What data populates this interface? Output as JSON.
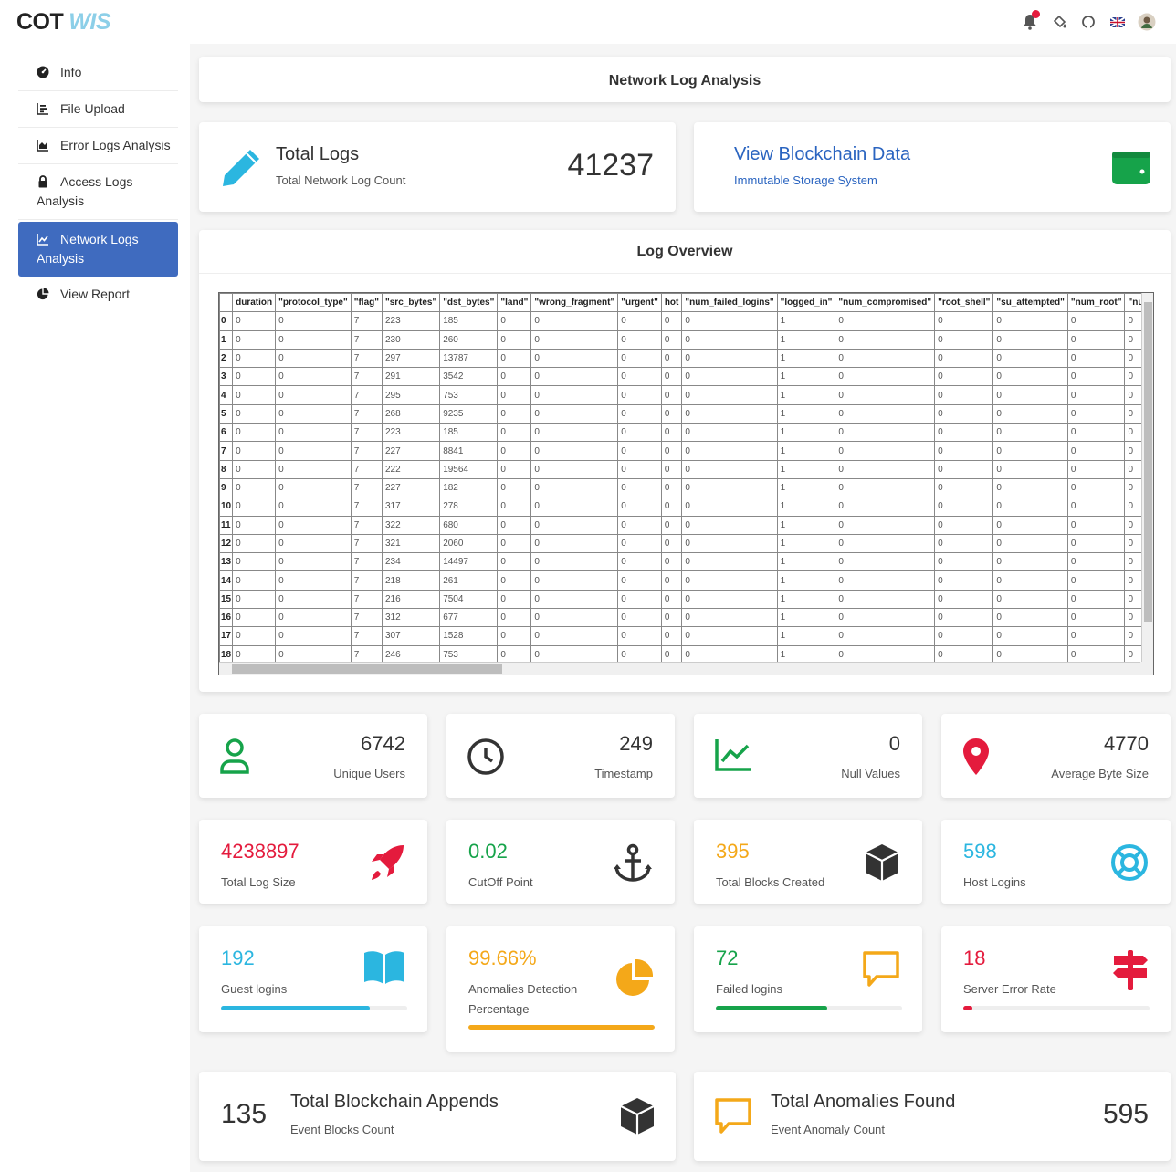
{
  "brand": {
    "part1": "COT",
    "part2": "WIS"
  },
  "colors": {
    "primary": "#3f6bbf",
    "green": "#16a34a",
    "red": "#e41b3d",
    "cyan": "#2bb6e0",
    "orange": "#f4a819",
    "blue_link": "#2a64c0"
  },
  "top_icons": [
    "bell-icon",
    "paint-bucket-icon",
    "github-icon",
    "flag-uk-icon",
    "avatar"
  ],
  "sidebar": {
    "items": [
      {
        "label": "Info",
        "icon": "dashboard-icon"
      },
      {
        "label": "File Upload",
        "icon": "bar-chart-icon"
      },
      {
        "label": "Error Logs Analysis",
        "icon": "area-chart-icon"
      },
      {
        "label": "Access Logs Analysis",
        "icon": "lock-icon"
      },
      {
        "label": "Network Logs Analysis",
        "icon": "line-chart-icon"
      },
      {
        "label": "View Report",
        "icon": "pie-chart-icon"
      }
    ]
  },
  "header": {
    "title": "Network Log Analysis"
  },
  "total_logs": {
    "title": "Total Logs",
    "subtitle": "Total Network Log Count",
    "value": "41237"
  },
  "blockchain": {
    "title": "View Blockchain Data",
    "subtitle": "Immutable Storage System"
  },
  "overview": {
    "title": "Log Overview",
    "columns": [
      "",
      "duration",
      "\"protocol_type\"",
      "\"flag\"",
      "\"src_bytes\"",
      "\"dst_bytes\"",
      "\"land\"",
      "\"wrong_fragment\"",
      "\"urgent\"",
      "hot",
      "\"num_failed_logins\"",
      "\"logged_in\"",
      "\"num_compromised\"",
      "\"root_shell\"",
      "\"su_attempted\"",
      "\"num_root\"",
      "\"num_file_creatio"
    ],
    "rows": [
      [
        "0",
        "0",
        "0",
        "7",
        "223",
        "185",
        "0",
        "0",
        "0",
        "0",
        "0",
        "1",
        "0",
        "0",
        "0",
        "0",
        "0"
      ],
      [
        "1",
        "0",
        "0",
        "7",
        "230",
        "260",
        "0",
        "0",
        "0",
        "0",
        "0",
        "1",
        "0",
        "0",
        "0",
        "0",
        "0"
      ],
      [
        "2",
        "0",
        "0",
        "7",
        "297",
        "13787",
        "0",
        "0",
        "0",
        "0",
        "0",
        "1",
        "0",
        "0",
        "0",
        "0",
        "0"
      ],
      [
        "3",
        "0",
        "0",
        "7",
        "291",
        "3542",
        "0",
        "0",
        "0",
        "0",
        "0",
        "1",
        "0",
        "0",
        "0",
        "0",
        "0"
      ],
      [
        "4",
        "0",
        "0",
        "7",
        "295",
        "753",
        "0",
        "0",
        "0",
        "0",
        "0",
        "1",
        "0",
        "0",
        "0",
        "0",
        "0"
      ],
      [
        "5",
        "0",
        "0",
        "7",
        "268",
        "9235",
        "0",
        "0",
        "0",
        "0",
        "0",
        "1",
        "0",
        "0",
        "0",
        "0",
        "0"
      ],
      [
        "6",
        "0",
        "0",
        "7",
        "223",
        "185",
        "0",
        "0",
        "0",
        "0",
        "0",
        "1",
        "0",
        "0",
        "0",
        "0",
        "0"
      ],
      [
        "7",
        "0",
        "0",
        "7",
        "227",
        "8841",
        "0",
        "0",
        "0",
        "0",
        "0",
        "1",
        "0",
        "0",
        "0",
        "0",
        "0"
      ],
      [
        "8",
        "0",
        "0",
        "7",
        "222",
        "19564",
        "0",
        "0",
        "0",
        "0",
        "0",
        "1",
        "0",
        "0",
        "0",
        "0",
        "0"
      ],
      [
        "9",
        "0",
        "0",
        "7",
        "227",
        "182",
        "0",
        "0",
        "0",
        "0",
        "0",
        "1",
        "0",
        "0",
        "0",
        "0",
        "0"
      ],
      [
        "10",
        "0",
        "0",
        "7",
        "317",
        "278",
        "0",
        "0",
        "0",
        "0",
        "0",
        "1",
        "0",
        "0",
        "0",
        "0",
        "0"
      ],
      [
        "11",
        "0",
        "0",
        "7",
        "322",
        "680",
        "0",
        "0",
        "0",
        "0",
        "0",
        "1",
        "0",
        "0",
        "0",
        "0",
        "0"
      ],
      [
        "12",
        "0",
        "0",
        "7",
        "321",
        "2060",
        "0",
        "0",
        "0",
        "0",
        "0",
        "1",
        "0",
        "0",
        "0",
        "0",
        "0"
      ],
      [
        "13",
        "0",
        "0",
        "7",
        "234",
        "14497",
        "0",
        "0",
        "0",
        "0",
        "0",
        "1",
        "0",
        "0",
        "0",
        "0",
        "0"
      ],
      [
        "14",
        "0",
        "0",
        "7",
        "218",
        "261",
        "0",
        "0",
        "0",
        "0",
        "0",
        "1",
        "0",
        "0",
        "0",
        "0",
        "0"
      ],
      [
        "15",
        "0",
        "0",
        "7",
        "216",
        "7504",
        "0",
        "0",
        "0",
        "0",
        "0",
        "1",
        "0",
        "0",
        "0",
        "0",
        "0"
      ],
      [
        "16",
        "0",
        "0",
        "7",
        "312",
        "677",
        "0",
        "0",
        "0",
        "0",
        "0",
        "1",
        "0",
        "0",
        "0",
        "0",
        "0"
      ],
      [
        "17",
        "0",
        "0",
        "7",
        "307",
        "1528",
        "0",
        "0",
        "0",
        "0",
        "0",
        "1",
        "0",
        "0",
        "0",
        "0",
        "0"
      ],
      [
        "18",
        "0",
        "0",
        "7",
        "246",
        "753",
        "0",
        "0",
        "0",
        "0",
        "0",
        "1",
        "0",
        "0",
        "0",
        "0",
        "0"
      ]
    ]
  },
  "stats": [
    {
      "value": "6742",
      "label": "Unique Users",
      "icon": "user-icon",
      "color": "#16a34a"
    },
    {
      "value": "249",
      "label": "Timestamp",
      "icon": "clock-icon",
      "color": "#333333"
    },
    {
      "value": "0",
      "label": "Null Values",
      "icon": "line-chart-icon",
      "color": "#16a34a"
    },
    {
      "value": "4770",
      "label": "Average Byte Size",
      "icon": "map-pin-icon",
      "color": "#e41b3d"
    }
  ],
  "metrics": [
    {
      "value": "4238897",
      "label": "Total Log Size",
      "icon": "rocket-icon",
      "color": "#e41b3d"
    },
    {
      "value": "0.02",
      "label": "CutOff Point",
      "icon": "anchor-icon",
      "color": "#16a34a"
    },
    {
      "value": "395",
      "label": "Total Blocks Created",
      "icon": "cube-icon",
      "color": "#f4a819"
    },
    {
      "value": "598",
      "label": "Host Logins",
      "icon": "life-ring-icon",
      "color": "#2bb6e0"
    }
  ],
  "progress": [
    {
      "value": "192",
      "label": "Guest logins",
      "icon": "book-icon",
      "color": "#2bb6e0",
      "fill_percent": 80
    },
    {
      "value": "99.66%",
      "label": "Anomalies Detection Percentage",
      "icon": "pie-chart-icon",
      "color": "#f4a819",
      "fill_percent": 100
    },
    {
      "value": "72",
      "label": "Failed logins",
      "icon": "comment-icon",
      "color": "#16a34a",
      "fill_percent": 60
    },
    {
      "value": "18",
      "label": "Server Error Rate",
      "icon": "signpost-icon",
      "color": "#e41b3d",
      "fill_percent": 5
    }
  ],
  "bottom": [
    {
      "value": "135",
      "title": "Total Blockchain Appends",
      "subtitle": "Event Blocks Count",
      "icon": "cube-icon"
    },
    {
      "value": "595",
      "title": "Total Anomalies Found",
      "subtitle": "Event Anomaly Count",
      "icon": "comment-icon"
    }
  ]
}
